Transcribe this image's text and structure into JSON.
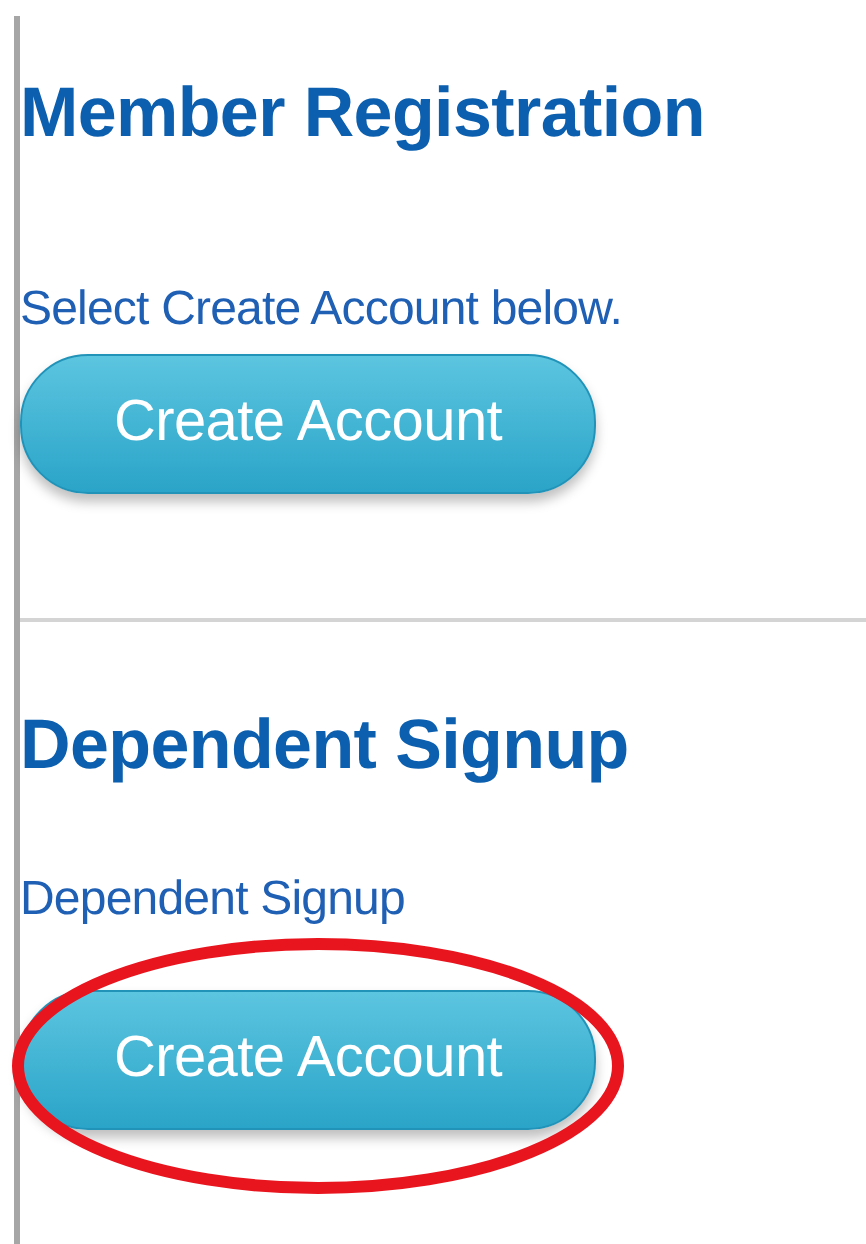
{
  "sections": [
    {
      "heading": "Member Registration",
      "text": "Select Create Account below.",
      "button": "Create Account",
      "circled": false
    },
    {
      "heading": "Dependent Signup",
      "text": "Dependent Signup",
      "button": "Create Account",
      "circled": true
    }
  ]
}
